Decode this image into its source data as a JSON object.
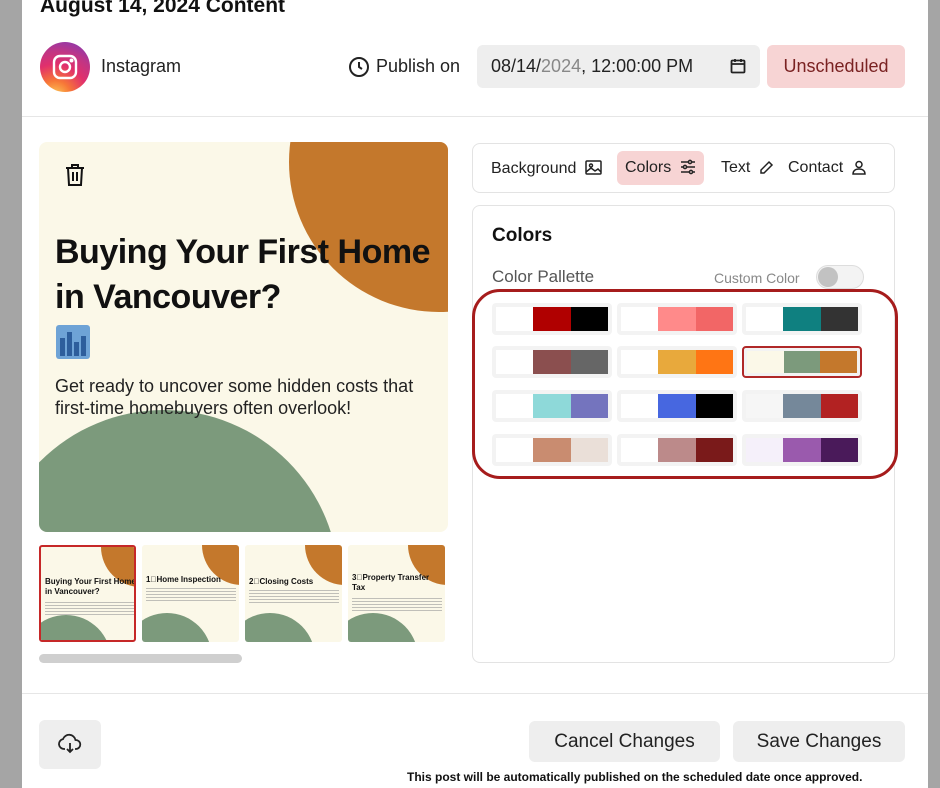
{
  "modal": {
    "title": "August 14, 2024 Content"
  },
  "post": {
    "platform": "Instagram",
    "publish_label": "Publish on",
    "date_month_day": "08/14/",
    "date_year": "2024",
    "date_time": ", 12:00:00 PM",
    "status": "Unscheduled"
  },
  "preview": {
    "headline": "Buying Your First Home in Vancouver?",
    "subtext": "Get ready to uncover some hidden costs that first-time homebuyers often overlook!",
    "colors": {
      "background": "#fbf8e8",
      "top_circle": "#c4782c",
      "bottom_circle": "#7c9a7c"
    }
  },
  "thumbnails": [
    {
      "title": "Buying Your First Home in Vancouver?",
      "active": true
    },
    {
      "title": "1⃣Home Inspection",
      "active": false
    },
    {
      "title": "2⃣Closing Costs",
      "active": false
    },
    {
      "title": "3⃣Property Transfer Tax",
      "active": false
    }
  ],
  "tabs": [
    {
      "label": "Background",
      "icon": "image-icon",
      "active": false
    },
    {
      "label": "Colors",
      "icon": "sliders-icon",
      "active": true
    },
    {
      "label": "Text",
      "icon": "pencil-icon",
      "active": false
    },
    {
      "label": "Contact",
      "icon": "user-icon",
      "active": false
    }
  ],
  "colors_panel": {
    "title": "Colors",
    "subtitle": "Color Pallette",
    "custom_label": "Custom Color",
    "custom_enabled": false
  },
  "palettes": [
    [
      "#ffffff",
      "#b00000",
      "#000000"
    ],
    [
      "#ffffff",
      "#ff8a8a",
      "#f26666"
    ],
    [
      "#ffffff",
      "#0f8080",
      "#333333"
    ],
    [
      "#ffffff",
      "#8b4f4f",
      "#666666"
    ],
    [
      "#ffffff",
      "#e8a93c",
      "#ff7514"
    ],
    [
      "#fbf8e8",
      "#7c9a7c",
      "#c4782c"
    ],
    [
      "#ffffff",
      "#8ed9d9",
      "#7474be"
    ],
    [
      "#ffffff",
      "#4767e0",
      "#000000"
    ],
    [
      "#f6f6f6",
      "#75889a",
      "#b22222"
    ],
    [
      "#ffffff",
      "#c98c70",
      "#eadfd8"
    ],
    [
      "#ffffff",
      "#bc8a8a",
      "#7a1a1a"
    ],
    [
      "#f5f0fa",
      "#9a5aad",
      "#4a1a5a"
    ]
  ],
  "selected_palette": 5,
  "footer": {
    "cancel": "Cancel Changes",
    "save": "Save Changes",
    "note": "This post will be automatically published on the scheduled date once approved."
  }
}
